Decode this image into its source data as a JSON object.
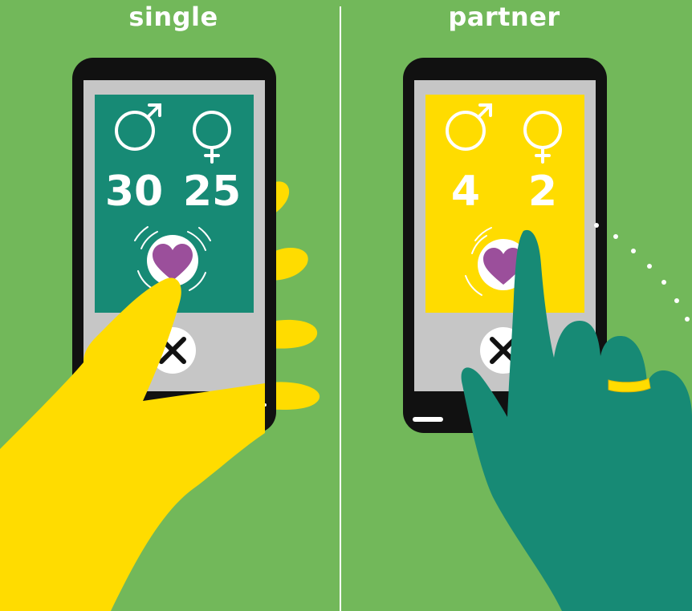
{
  "left_panel": {
    "title": "single",
    "male_count": "30",
    "female_count": "25"
  },
  "right_panel": {
    "title": "partner",
    "male_count": "4",
    "female_count": "2"
  },
  "icons": {
    "male": "male-symbol-icon",
    "female": "female-symbol-icon",
    "like": "heart-icon",
    "reject": "close-icon"
  },
  "colors": {
    "background": "#72b85a",
    "single_screen": "#178a75",
    "partner_screen": "#ffdc00",
    "heart": "#9b4f9b",
    "yellow_hand": "#ffdc00",
    "teal_hand": "#178a75"
  }
}
